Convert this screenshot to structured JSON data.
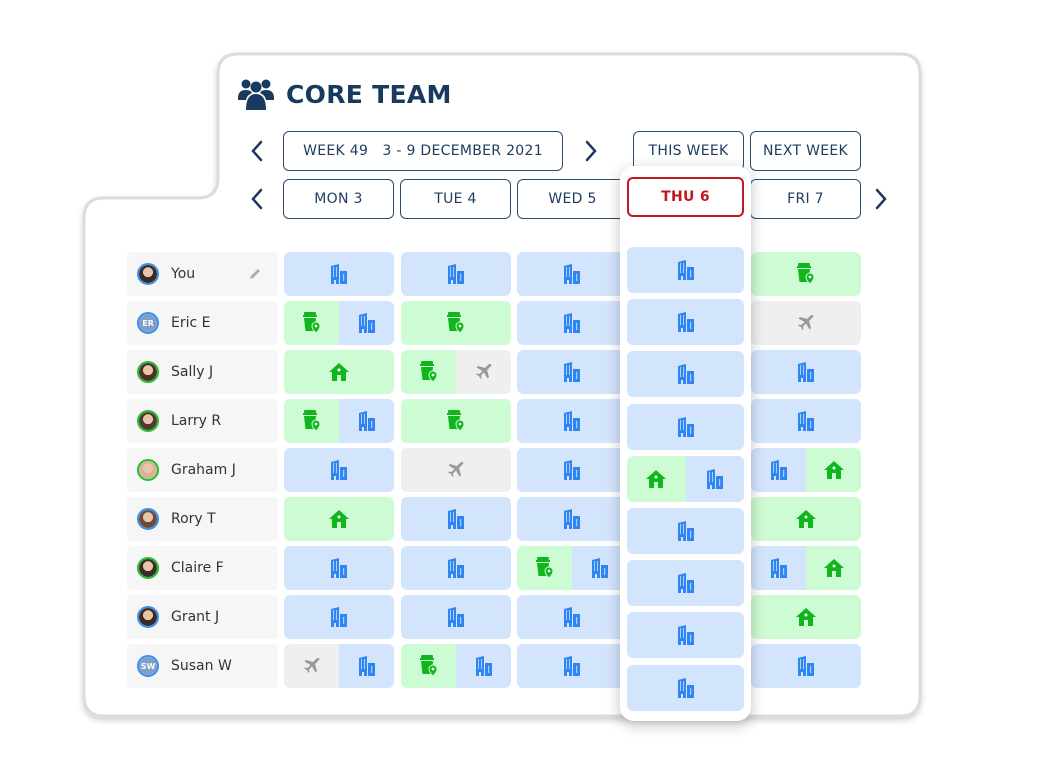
{
  "header": {
    "title": "CORE TEAM",
    "icon": "users-icon"
  },
  "week_nav": {
    "week_label": "WEEK 49   3 - 9 DECEMBER 2021",
    "this_week_label": "THIS WEEK",
    "next_week_label": "NEXT WEEK"
  },
  "days": [
    {
      "label": "MON 3",
      "today": false
    },
    {
      "label": "TUE 4",
      "today": false
    },
    {
      "label": "WED 5",
      "today": false
    },
    {
      "label": "THU 6",
      "today": true
    },
    {
      "label": "FRI 7",
      "today": false
    }
  ],
  "colors": {
    "primary": "#1d3b5e",
    "today": "#c0181e",
    "office_bg": "#d3e5fd",
    "office_icon": "#2f86f2",
    "remote_bg": "#cdfbd3",
    "remote_icon": "#11b51e",
    "travel_bg": "#efefef",
    "travel_icon": "#999999"
  },
  "legend": {
    "office": "building-icon",
    "home": "home-icon",
    "remote": "coffee-location-icon",
    "travel": "plane-icon"
  },
  "people": [
    {
      "name": "You",
      "avatar": "photo",
      "ring": "blue",
      "editable": true,
      "schedule": [
        [
          "office"
        ],
        [
          "office"
        ],
        [
          "office"
        ],
        [
          "office"
        ],
        [
          "remote"
        ]
      ]
    },
    {
      "name": "Eric E",
      "avatar": "initials",
      "initials": "ER",
      "ring": "blue",
      "schedule": [
        [
          "remote",
          "office"
        ],
        [
          "remote"
        ],
        [
          "office"
        ],
        [
          "office"
        ],
        [
          "travel"
        ]
      ]
    },
    {
      "name": "Sally J",
      "avatar": "photo",
      "ring": "green",
      "schedule": [
        [
          "home"
        ],
        [
          "remote",
          "travel"
        ],
        [
          "office"
        ],
        [
          "office"
        ],
        [
          "office"
        ]
      ]
    },
    {
      "name": "Larry R",
      "avatar": "photo",
      "ring": "green",
      "schedule": [
        [
          "remote",
          "office"
        ],
        [
          "remote"
        ],
        [
          "office"
        ],
        [
          "office"
        ],
        [
          "office"
        ]
      ]
    },
    {
      "name": "Graham J",
      "avatar": "photo",
      "ring": "green",
      "schedule": [
        [
          "office"
        ],
        [
          "travel"
        ],
        [
          "office"
        ],
        [
          "home",
          "office"
        ],
        [
          "office",
          "home"
        ]
      ]
    },
    {
      "name": "Rory T",
      "avatar": "photo",
      "ring": "blue",
      "schedule": [
        [
          "home"
        ],
        [
          "office"
        ],
        [
          "office"
        ],
        [
          "office"
        ],
        [
          "home"
        ]
      ]
    },
    {
      "name": "Claire F",
      "avatar": "photo",
      "ring": "green",
      "schedule": [
        [
          "office"
        ],
        [
          "office"
        ],
        [
          "remote",
          "office"
        ],
        [
          "office"
        ],
        [
          "office",
          "home"
        ]
      ]
    },
    {
      "name": "Grant J",
      "avatar": "photo",
      "ring": "blue",
      "schedule": [
        [
          "office"
        ],
        [
          "office"
        ],
        [
          "office"
        ],
        [
          "office"
        ],
        [
          "home"
        ]
      ]
    },
    {
      "name": "Susan W",
      "avatar": "initials",
      "initials": "SW",
      "ring": "blue",
      "schedule": [
        [
          "travel",
          "office"
        ],
        [
          "remote",
          "office"
        ],
        [
          "office"
        ],
        [
          "office"
        ],
        [
          "office"
        ]
      ]
    }
  ]
}
